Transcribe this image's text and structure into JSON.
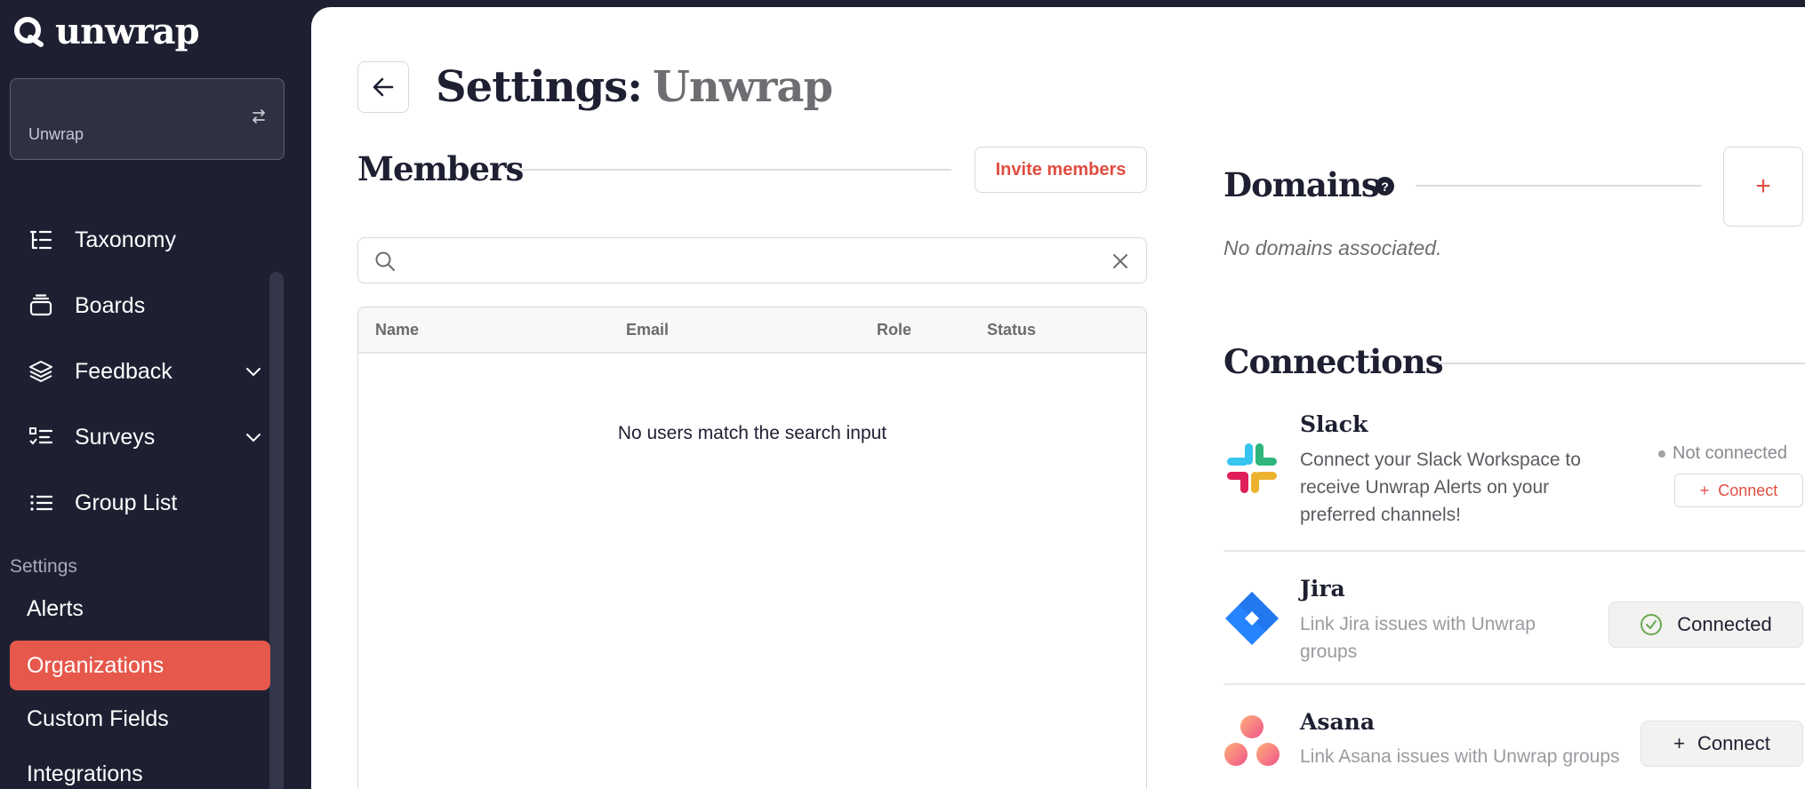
{
  "brand": {
    "name": "unwrap"
  },
  "org_switcher": {
    "name": "Unwrap"
  },
  "nav": {
    "items": [
      {
        "label": "Taxonomy"
      },
      {
        "label": "Boards"
      },
      {
        "label": "Feedback"
      },
      {
        "label": "Surveys"
      },
      {
        "label": "Group List"
      }
    ],
    "settings_label": "Settings",
    "settings_items": [
      {
        "label": "Alerts"
      },
      {
        "label": "Organizations"
      },
      {
        "label": "Custom Fields"
      },
      {
        "label": "Integrations"
      }
    ]
  },
  "header": {
    "title_prefix": "Settings:",
    "title_org": "Unwrap"
  },
  "members": {
    "title": "Members",
    "invite_label": "Invite members",
    "search_value": "",
    "columns": [
      "Name",
      "Email",
      "Role",
      "Status"
    ],
    "empty_message": "No users match the search input"
  },
  "domains": {
    "title": "Domains",
    "help": "?",
    "add": "+",
    "empty_message": "No domains associated."
  },
  "connections": {
    "title": "Connections",
    "items": [
      {
        "name": "Slack",
        "desc_lines": [
          "Connect your Slack Workspace to",
          "receive Unwrap Alerts on your",
          "preferred channels!"
        ],
        "status": "Not connected",
        "action": "Connect"
      },
      {
        "name": "Jira",
        "desc_lines": [
          "Link Jira issues with Unwrap",
          "groups"
        ],
        "action": "Connected"
      },
      {
        "name": "Asana",
        "desc_lines": [
          "Link Asana issues with Unwrap groups"
        ],
        "action": "Connect"
      }
    ]
  },
  "colors": {
    "accent": "#e6584b",
    "sidebar": "#1e2032"
  }
}
